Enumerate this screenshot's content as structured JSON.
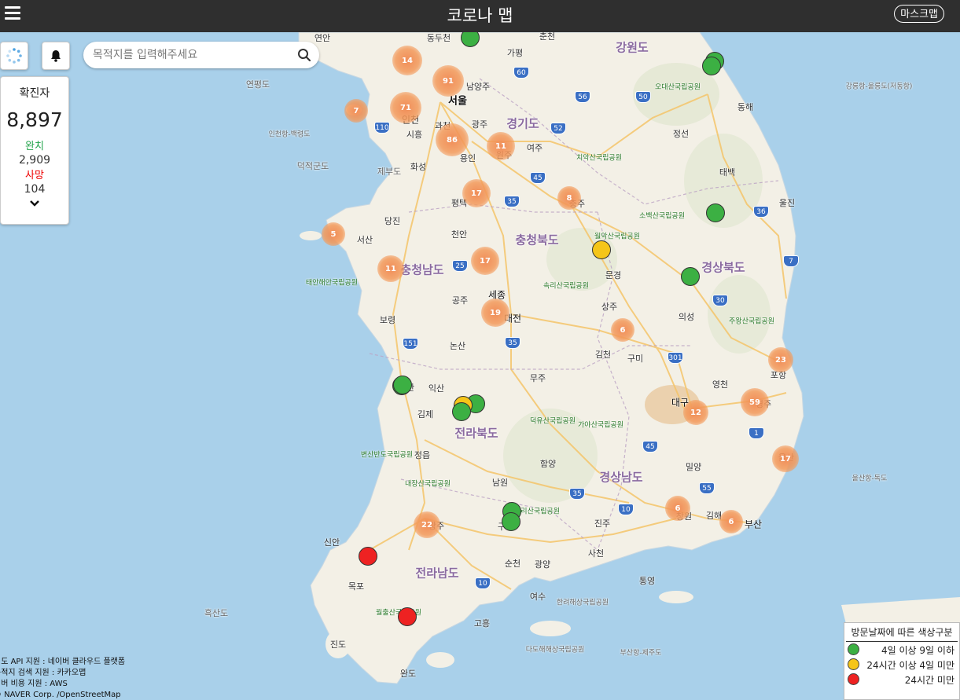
{
  "header": {
    "title": "코로나 맵",
    "mask_button": "마스크맵"
  },
  "search": {
    "placeholder": "목적지를 입력해주세요"
  },
  "stats": {
    "confirmed_label": "확진자",
    "confirmed": "8,897",
    "recovered_label": "완치",
    "recovered": "2,909",
    "death_label": "사망",
    "death": "104"
  },
  "legend": {
    "title": "방문날짜에 따른 색상구분",
    "items": [
      {
        "label": "4일 이상 9일 이하",
        "color": "#3cb043"
      },
      {
        "label": "24시간 이상 4일 미만",
        "color": "#f5c518"
      },
      {
        "label": "24시간 미만",
        "color": "#ee2222"
      }
    ]
  },
  "attribution": [
    "지도 API 지원 : 네이버 클라우드 플랫폼",
    "목적지 검색 지원 : 카카오맵",
    "서버 비용 지원 : AWS",
    "© NAVER Corp. /OpenStreetMap"
  ],
  "colors": {
    "cluster": "#f39a5b",
    "green": "#3cb043",
    "yellow": "#f5c518",
    "red": "#ee2222",
    "sea": "#a8cfe8",
    "land": "#f4f1e8"
  },
  "clusters": [
    "14",
    "91",
    "71",
    "7",
    "86",
    "11",
    "17",
    "8",
    "5",
    "11",
    "17",
    "19",
    "6",
    "23",
    "59",
    "12",
    "17",
    "22",
    "6",
    "6"
  ],
  "place_labels": [
    "연안",
    "동두천",
    "춘천",
    "강원도",
    "가평",
    "오대산국립공원",
    "남양주",
    "서울",
    "연평도",
    "인천",
    "강릉항-울릉도(저동항)",
    "동해",
    "과천",
    "광주",
    "경기도",
    "여주",
    "인천항-백령도",
    "시흥",
    "원주",
    "정선",
    "치악산국립공원",
    "덕적군도",
    "화성",
    "제부도",
    "용인",
    "태백",
    "충주",
    "소백산국립공원",
    "울진",
    "평택",
    "당진",
    "천안",
    "서산",
    "월악산국립공원",
    "충청북도",
    "태안해안국립공원",
    "충청남도",
    "문경",
    "경상북도",
    "세종",
    "속리산국립공원",
    "공주",
    "상주",
    "의성",
    "보령",
    "대전",
    "주왕산국립공원",
    "김천",
    "구미",
    "논산",
    "포항",
    "영천",
    "익산",
    "무주",
    "대구",
    "군산",
    "김제",
    "덕유산국립공원",
    "경주",
    "전라북도",
    "가야산국립공원",
    "변산반도국립공원",
    "정읍",
    "함양",
    "울산",
    "밀양",
    "경상남도",
    "내장산국립공원",
    "남원",
    "울산항-독도",
    "지리산국립공원",
    "진주",
    "김해",
    "부산",
    "창원",
    "구례",
    "광주",
    "신안",
    "전라남도",
    "순천",
    "광양",
    "사천",
    "목포",
    "통영",
    "여수",
    "흑산도",
    "한려해상국립공원",
    "월출산국립공원",
    "고흥",
    "진도",
    "다도해해상국립공원",
    "완도",
    "부산항-제주도"
  ],
  "highway_numbers": [
    "110",
    "60",
    "56",
    "50",
    "52",
    "45",
    "35",
    "36",
    "25",
    "7",
    "151",
    "30",
    "301",
    "1",
    "35",
    "45",
    "55",
    "10",
    "35",
    "10"
  ]
}
